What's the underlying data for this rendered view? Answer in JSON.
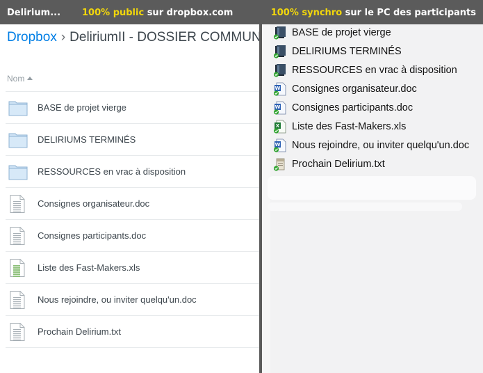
{
  "banner": {
    "left": "Delirium...",
    "mid_hl": "100% public",
    "mid_rest": " sur dropbox.com",
    "right_hl": "100% synchro",
    "right_rest": " sur le PC des participants"
  },
  "web": {
    "breadcrumb_root": "Dropbox",
    "breadcrumb_sep": "›",
    "breadcrumb_folder": "DeliriumII - DOSSIER COMMUN",
    "column_header": "Nom",
    "files": [
      {
        "name": "BASE de projet vierge",
        "type": "folder"
      },
      {
        "name": "DELIRIUMS TERMINÉS",
        "type": "folder"
      },
      {
        "name": "RESSOURCES en vrac à disposition",
        "type": "folder"
      },
      {
        "name": "Consignes organisateur.doc",
        "type": "doc"
      },
      {
        "name": "Consignes participants.doc",
        "type": "doc"
      },
      {
        "name": "Liste des Fast-Makers.xls",
        "type": "xls"
      },
      {
        "name": "Nous rejoindre, ou inviter quelqu'un.doc",
        "type": "doc"
      },
      {
        "name": "Prochain Delirium.txt",
        "type": "txt"
      }
    ]
  },
  "explorer": {
    "files": [
      {
        "name": "BASE de projet vierge",
        "type": "folder"
      },
      {
        "name": "DELIRIUMS TERMINÉS",
        "type": "folder"
      },
      {
        "name": "RESSOURCES en vrac à disposition",
        "type": "folder"
      },
      {
        "name": "Consignes organisateur.doc",
        "type": "doc"
      },
      {
        "name": "Consignes participants.doc",
        "type": "doc"
      },
      {
        "name": "Liste des Fast-Makers.xls",
        "type": "xls"
      },
      {
        "name": "Nous rejoindre, ou inviter quelqu'un.doc",
        "type": "doc"
      },
      {
        "name": "Prochain Delirium.txt",
        "type": "txt"
      }
    ]
  },
  "colors": {
    "banner_bg": "#5b5b5b",
    "banner_highlight": "#f2d70b",
    "dropbox_blue": "#007ee5",
    "sync_green": "#2fa32f"
  }
}
